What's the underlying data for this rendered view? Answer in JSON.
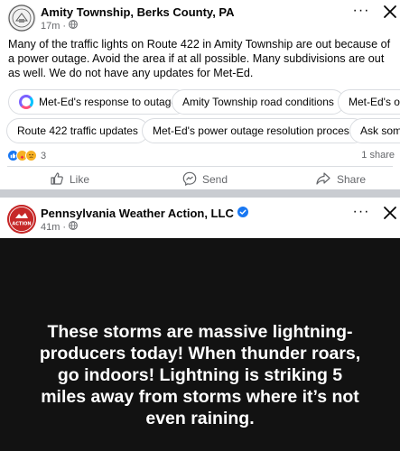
{
  "post1": {
    "page_name": "Amity Township, Berks County, PA",
    "time": "17m",
    "visibility_icon": "globe-icon",
    "more_label": "···",
    "body": "Many of the traffic lights on Route 422 in Amity Township are out because of a power outage. Avoid the area if at all possible. Many subdivisions are out as well. We do not have any updates for Met-Ed.",
    "suggestions_row1": [
      "Met-Ed's response to outage",
      "Amity Township road conditions",
      "Met-Ed's ou"
    ],
    "suggestions_row2": [
      "Route 422 traffic updates",
      "Met-Ed's power outage resolution process",
      "Ask some"
    ],
    "reaction_count": "3",
    "shares": "1 share",
    "actions": {
      "like": "Like",
      "send": "Send",
      "share": "Share"
    }
  },
  "post2": {
    "page_name": "Pennsylvania Weather Action, LLC",
    "verified_icon": "verified-badge-icon",
    "time": "41m",
    "visibility_icon": "globe-icon",
    "more_label": "···",
    "avatar_text": "ACTION",
    "image_text": "These storms are massive lightning-producers today! When thunder roars, go indoors! Lightning is striking 5 miles away from storms where it’s not even raining."
  },
  "colors": {
    "accent_blue": "#1877f2",
    "muted": "#65676b",
    "divider": "#c9ccd1",
    "image_bg": "#121212"
  }
}
